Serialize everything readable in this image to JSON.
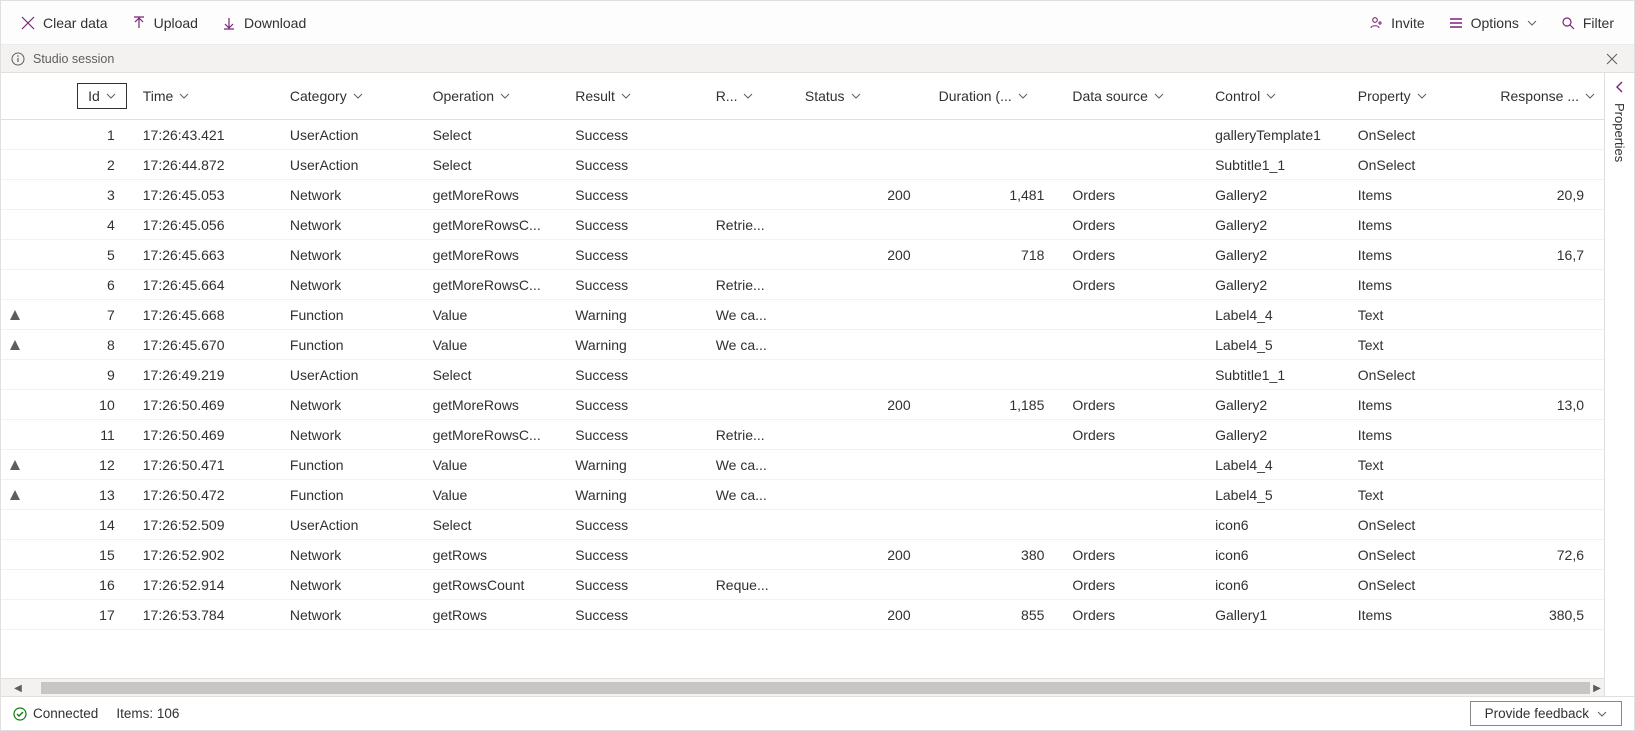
{
  "toolbar": {
    "clear": "Clear data",
    "upload": "Upload",
    "download": "Download",
    "invite": "Invite",
    "options": "Options",
    "filter": "Filter"
  },
  "session": {
    "label": "Studio session"
  },
  "columns": {
    "id": "Id",
    "time": "Time",
    "category": "Category",
    "operation": "Operation",
    "result": "Result",
    "rinfo": "R...",
    "status": "Status",
    "duration": "Duration (...",
    "datasource": "Data source",
    "control": "Control",
    "property": "Property",
    "response": "Response ..."
  },
  "rows": [
    {
      "warn": false,
      "id": "1",
      "time": "17:26:43.421",
      "category": "UserAction",
      "operation": "Select",
      "result": "Success",
      "rinfo": "",
      "status": "",
      "duration": "",
      "datasource": "",
      "control": "galleryTemplate1",
      "property": "OnSelect",
      "response": ""
    },
    {
      "warn": false,
      "id": "2",
      "time": "17:26:44.872",
      "category": "UserAction",
      "operation": "Select",
      "result": "Success",
      "rinfo": "",
      "status": "",
      "duration": "",
      "datasource": "",
      "control": "Subtitle1_1",
      "property": "OnSelect",
      "response": ""
    },
    {
      "warn": false,
      "id": "3",
      "time": "17:26:45.053",
      "category": "Network",
      "operation": "getMoreRows",
      "result": "Success",
      "rinfo": "",
      "status": "200",
      "duration": "1,481",
      "datasource": "Orders",
      "control": "Gallery2",
      "property": "Items",
      "response": "20,9"
    },
    {
      "warn": false,
      "id": "4",
      "time": "17:26:45.056",
      "category": "Network",
      "operation": "getMoreRowsC...",
      "result": "Success",
      "rinfo": "Retrie...",
      "status": "",
      "duration": "",
      "datasource": "Orders",
      "control": "Gallery2",
      "property": "Items",
      "response": ""
    },
    {
      "warn": false,
      "id": "5",
      "time": "17:26:45.663",
      "category": "Network",
      "operation": "getMoreRows",
      "result": "Success",
      "rinfo": "",
      "status": "200",
      "duration": "718",
      "datasource": "Orders",
      "control": "Gallery2",
      "property": "Items",
      "response": "16,7"
    },
    {
      "warn": false,
      "id": "6",
      "time": "17:26:45.664",
      "category": "Network",
      "operation": "getMoreRowsC...",
      "result": "Success",
      "rinfo": "Retrie...",
      "status": "",
      "duration": "",
      "datasource": "Orders",
      "control": "Gallery2",
      "property": "Items",
      "response": ""
    },
    {
      "warn": true,
      "id": "7",
      "time": "17:26:45.668",
      "category": "Function",
      "operation": "Value",
      "result": "Warning",
      "rinfo": "We ca...",
      "status": "",
      "duration": "",
      "datasource": "",
      "control": "Label4_4",
      "property": "Text",
      "response": ""
    },
    {
      "warn": true,
      "id": "8",
      "time": "17:26:45.670",
      "category": "Function",
      "operation": "Value",
      "result": "Warning",
      "rinfo": "We ca...",
      "status": "",
      "duration": "",
      "datasource": "",
      "control": "Label4_5",
      "property": "Text",
      "response": ""
    },
    {
      "warn": false,
      "id": "9",
      "time": "17:26:49.219",
      "category": "UserAction",
      "operation": "Select",
      "result": "Success",
      "rinfo": "",
      "status": "",
      "duration": "",
      "datasource": "",
      "control": "Subtitle1_1",
      "property": "OnSelect",
      "response": ""
    },
    {
      "warn": false,
      "id": "10",
      "time": "17:26:50.469",
      "category": "Network",
      "operation": "getMoreRows",
      "result": "Success",
      "rinfo": "",
      "status": "200",
      "duration": "1,185",
      "datasource": "Orders",
      "control": "Gallery2",
      "property": "Items",
      "response": "13,0"
    },
    {
      "warn": false,
      "id": "11",
      "time": "17:26:50.469",
      "category": "Network",
      "operation": "getMoreRowsC...",
      "result": "Success",
      "rinfo": "Retrie...",
      "status": "",
      "duration": "",
      "datasource": "Orders",
      "control": "Gallery2",
      "property": "Items",
      "response": ""
    },
    {
      "warn": true,
      "id": "12",
      "time": "17:26:50.471",
      "category": "Function",
      "operation": "Value",
      "result": "Warning",
      "rinfo": "We ca...",
      "status": "",
      "duration": "",
      "datasource": "",
      "control": "Label4_4",
      "property": "Text",
      "response": ""
    },
    {
      "warn": true,
      "id": "13",
      "time": "17:26:50.472",
      "category": "Function",
      "operation": "Value",
      "result": "Warning",
      "rinfo": "We ca...",
      "status": "",
      "duration": "",
      "datasource": "",
      "control": "Label4_5",
      "property": "Text",
      "response": ""
    },
    {
      "warn": false,
      "id": "14",
      "time": "17:26:52.509",
      "category": "UserAction",
      "operation": "Select",
      "result": "Success",
      "rinfo": "",
      "status": "",
      "duration": "",
      "datasource": "",
      "control": "icon6",
      "property": "OnSelect",
      "response": ""
    },
    {
      "warn": false,
      "id": "15",
      "time": "17:26:52.902",
      "category": "Network",
      "operation": "getRows",
      "result": "Success",
      "rinfo": "",
      "status": "200",
      "duration": "380",
      "datasource": "Orders",
      "control": "icon6",
      "property": "OnSelect",
      "response": "72,6"
    },
    {
      "warn": false,
      "id": "16",
      "time": "17:26:52.914",
      "category": "Network",
      "operation": "getRowsCount",
      "result": "Success",
      "rinfo": "Reque...",
      "status": "",
      "duration": "",
      "datasource": "Orders",
      "control": "icon6",
      "property": "OnSelect",
      "response": ""
    },
    {
      "warn": false,
      "id": "17",
      "time": "17:26:53.784",
      "category": "Network",
      "operation": "getRows",
      "result": "Success",
      "rinfo": "",
      "status": "200",
      "duration": "855",
      "datasource": "Orders",
      "control": "Gallery1",
      "property": "Items",
      "response": "380,5"
    }
  ],
  "status": {
    "connected": "Connected",
    "items": "Items: 106",
    "feedback": "Provide feedback"
  },
  "rightpanel": {
    "label": "Properties"
  }
}
